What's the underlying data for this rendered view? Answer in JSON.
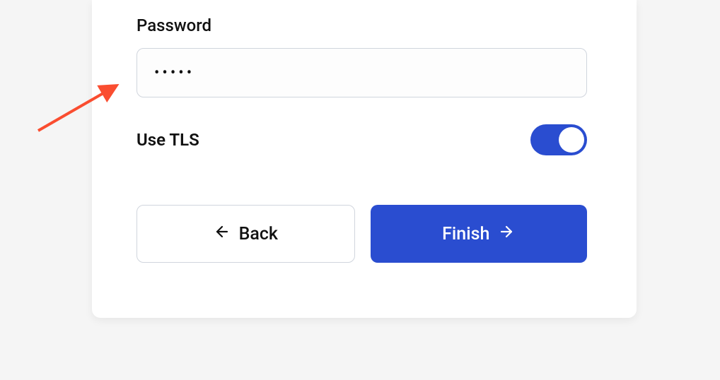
{
  "form": {
    "password_label": "Password",
    "password_value": "•••••",
    "tls_label": "Use TLS",
    "tls_enabled": true
  },
  "buttons": {
    "back_label": "Back",
    "finish_label": "Finish"
  },
  "colors": {
    "accent": "#2a4dd0",
    "border": "#d0d5dd",
    "annotation": "#fa4d30"
  }
}
